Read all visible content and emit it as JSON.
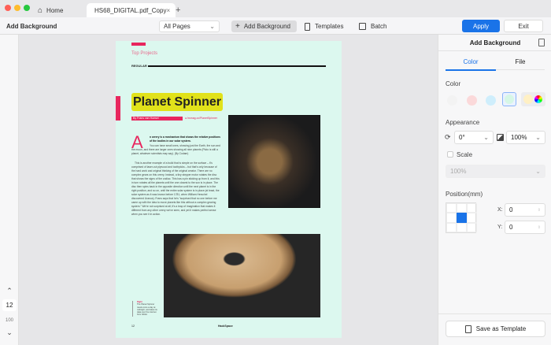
{
  "tabs": {
    "home": "Home",
    "document": "HS68_DIGITAL.pdf_Copy",
    "new_tab": "+",
    "close": "×"
  },
  "toolbar": {
    "title": "Add Background",
    "pages_select": "All Pages",
    "add_background": "Add Background",
    "templates": "Templates",
    "batch": "Batch",
    "apply": "Apply",
    "exit": "Exit"
  },
  "leftbar": {
    "page_number": "12",
    "zoom": "100"
  },
  "document": {
    "section": "Top Projects",
    "category": "REGULAR",
    "headline": "Planet Spinner",
    "byline": "By Frans van Hoesel",
    "link": "hsmag.cc/PlanetSpinner",
    "drop_cap": "A",
    "lead": "n orrery is a mechanism that shows the relative positions of the bodies in our solar system.",
    "para1": "You can have small ones, showing just the Earth, the sun and the moon, and there are larger ones showing all nine planets (Pluto is still a planet, whatever scientists may say). (By Codam)",
    "para2": "This is another example of a build that is simple on the surface – it's comprised of laser-cut plywood and toothpicks – but that's only because of the hard work and original thinking of the original creator. There are no complex gears on this orrery. Instead, a tiny stepper motor rotates the disc that shows the signs of the zodiac. This has a pin sticking up from it, and this in turn rotates all the planets until the one closest to the sun is in place. The disc then spins back in the opposite direction until the next planet is in the right position, and so on, until the entire solar system is in place (at least, the solar system as it was known before 1781, when William Herschel discovered Uranus). Frans says that he's \"surprised that no one before me came up with the idea to move planets like this without a complex gearing system.\" We're not surprised at all; it's a leap of imagination that makes it different from any other orrery we've seen, and yet it makes perfect sense when you see it in action.",
    "caption_title": "Right",
    "caption": "The Planet Spinner resets once a day at midnight, and takes its data over the internet from NASA",
    "footer_page": "12",
    "footer_brand": "HackSpace"
  },
  "panel": {
    "title": "Add Background",
    "tab_color": "Color",
    "tab_file": "File",
    "color_label": "Color",
    "appearance_label": "Appearance",
    "rotation": "0°",
    "opacity": "100%",
    "scale_label": "Scale",
    "scale_value": "100%",
    "position_label": "Position(mm)",
    "x_label": "X:",
    "x_value": "0",
    "y_label": "Y:",
    "y_value": "0",
    "save_template": "Save as Template"
  },
  "colors": {
    "accent": "#1a73e8",
    "page_bg": "#dcf8ef",
    "swatches": [
      "#f3f3f3",
      "#fbd9da",
      "#cfeefc",
      "#d6f7e6",
      "#fff0c4"
    ]
  }
}
